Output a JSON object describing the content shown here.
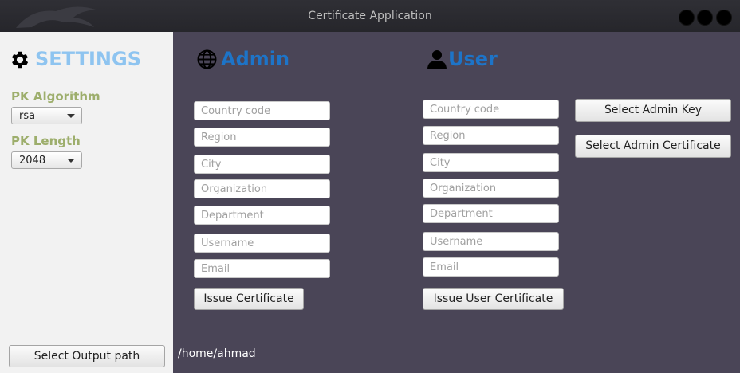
{
  "window": {
    "title": "Certificate Application"
  },
  "sidebar": {
    "title": "SETTINGS",
    "pk_algorithm_label": "PK Algorithm",
    "pk_algorithm_value": "rsa",
    "pk_length_label": "PK Length",
    "pk_length_value": "2048",
    "output_button": "Select Output path"
  },
  "admin": {
    "title": "Admin",
    "fields": {
      "country": "Country code",
      "region": "Region",
      "city": "City",
      "organization": "Organization",
      "department": "Department",
      "username": "Username",
      "email": "Email"
    },
    "issue_button": "Issue Certificate"
  },
  "user": {
    "title": "User",
    "fields": {
      "country": "Country code",
      "region": "Region",
      "city": "City",
      "organization": "Organization",
      "department": "Department",
      "username": "Username",
      "email": "Email"
    },
    "issue_button": "Issue User Certificate",
    "select_admin_key": "Select Admin Key",
    "select_admin_cert": "Select Admin Certificate"
  },
  "output_path": "/home/ahmad",
  "icons": {
    "settings": "gear-icon",
    "admin": "globe-icon",
    "user": "user-icon"
  }
}
